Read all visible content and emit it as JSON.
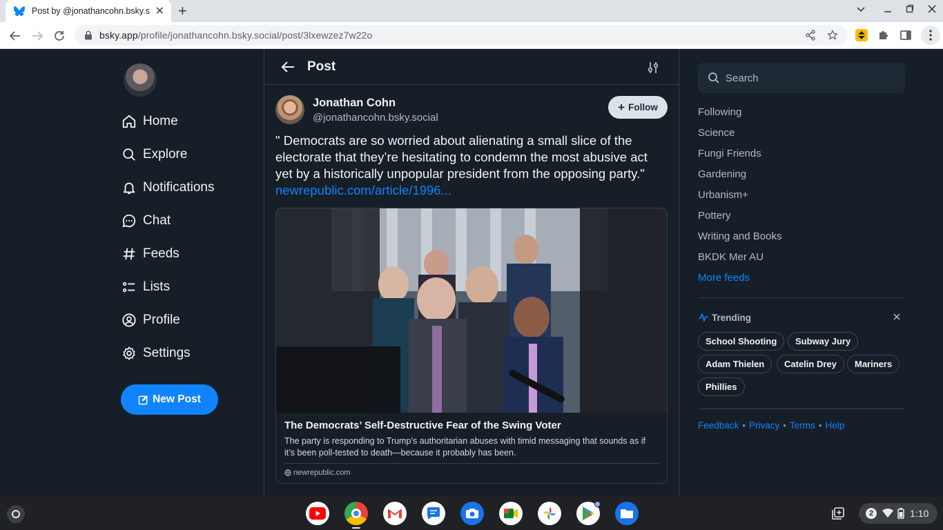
{
  "browser": {
    "tab_title": "Post by @jonathancohn.bsky.soc",
    "url_domain": "bsky.app",
    "url_path": "/profile/jonathancohn.bsky.social/post/3lxewzez7w22o"
  },
  "nav": {
    "items": [
      {
        "label": "Home",
        "icon": "home-icon"
      },
      {
        "label": "Explore",
        "icon": "search-icon"
      },
      {
        "label": "Notifications",
        "icon": "bell-icon"
      },
      {
        "label": "Chat",
        "icon": "chat-icon"
      },
      {
        "label": "Feeds",
        "icon": "hash-icon"
      },
      {
        "label": "Lists",
        "icon": "list-icon"
      },
      {
        "label": "Profile",
        "icon": "user-circle-icon"
      },
      {
        "label": "Settings",
        "icon": "gear-icon"
      }
    ],
    "new_post_label": "New Post"
  },
  "header": {
    "title": "Post"
  },
  "post": {
    "author_name": "Jonathan Cohn",
    "author_handle": "@jonathancohn.bsky.social",
    "follow_label": "Follow",
    "text": "\" Democrats are so worried about alienating a small slice of the electorate that they’re hesitating to condemn the most abusive act yet by a historically unpopular president from the opposing party.\" ",
    "link_text": "newrepublic.com/article/1996...",
    "card": {
      "title": "The Democrats’ Self-Destructive Fear of the Swing Voter",
      "description": "The party is responding to Trump’s authoritarian abuses with timid messaging that sounds as if it’s been poll-tested to death—because it probably has been.",
      "domain": "newrepublic.com"
    }
  },
  "sidebar": {
    "search_placeholder": "Search",
    "feeds": [
      "Following",
      "Science",
      "Fungi Friends",
      "Gardening",
      "Urbanism+",
      "Pottery",
      "Writing and Books",
      "BKDK Mer AU"
    ],
    "more_feeds_label": "More feeds",
    "trending_label": "Trending",
    "trending": [
      "School Shooting",
      "Subway Jury",
      "Adam Thielen",
      "Catelin Drey",
      "Mariners",
      "Phillies"
    ],
    "footer_links": [
      "Feedback",
      "Privacy",
      "Terms",
      "Help"
    ]
  },
  "shelf": {
    "notification_count": "2",
    "time": "1:10"
  },
  "colors": {
    "accent": "#1083fe",
    "background": "#161e27",
    "border": "#2e4052"
  }
}
